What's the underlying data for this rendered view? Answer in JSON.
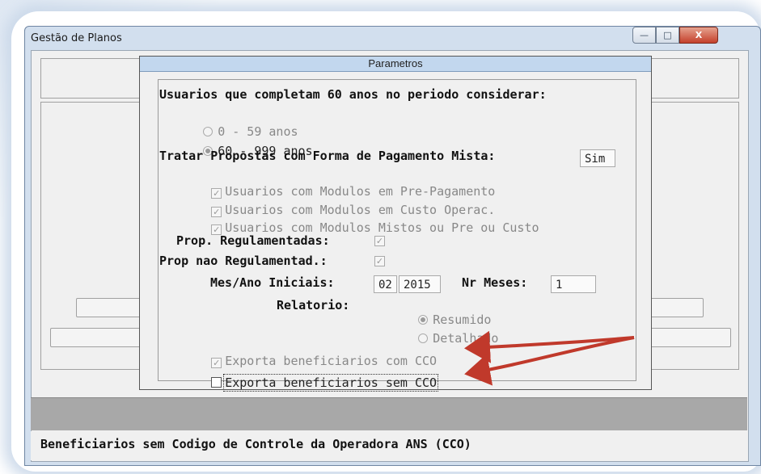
{
  "window": {
    "title": "Gestão de Planos",
    "minimize": "—",
    "maximize": "□",
    "close": "X"
  },
  "dialog": {
    "title": "Parametros",
    "heading": "Usuarios que completam 60 anos no periodo considerar:",
    "age_options": [
      {
        "label": "0 - 59 anos",
        "selected": false
      },
      {
        "label": "60 - 999 anos",
        "selected": true
      }
    ],
    "mixed_payment_label": "Tratar Propostas com Forma de Pagamento Mista:",
    "mixed_payment_value": "Sim",
    "module_options": [
      {
        "label": "Usuarios com Modulos em Pre-Pagamento",
        "checked": true
      },
      {
        "label": "Usuarios com Modulos em Custo Operac.",
        "checked": true
      },
      {
        "label": "Usuarios com Modulos Mistos ou Pre ou Custo",
        "checked": true
      }
    ],
    "prop_regulamentadas_label": "Prop. Regulamentadas:",
    "prop_nao_regulamentadas_label": "Prop nao Regulamentad.:",
    "mes_ano_label": "Mes/Ano Iniciais:",
    "mes_value": "02",
    "ano_value": "2015",
    "nr_meses_label": "Nr Meses:",
    "nr_meses_value": "1",
    "relatorio_label": "Relatorio:",
    "relatorio_options": [
      {
        "label": "Resumido",
        "selected": true
      },
      {
        "label": "Detalhado",
        "selected": false
      }
    ],
    "exporta_com_cco": "Exporta beneficiarios com CCO",
    "exporta_sem_cco": "Exporta beneficiarios sem CCO"
  },
  "status_bar": {
    "text": "Beneficiarios sem Codigo de Controle da Operadora ANS (CCO)"
  },
  "colors": {
    "arrow": "#c0392b",
    "title_bar": "#c2d7ee",
    "close_button": "#c4402b"
  }
}
